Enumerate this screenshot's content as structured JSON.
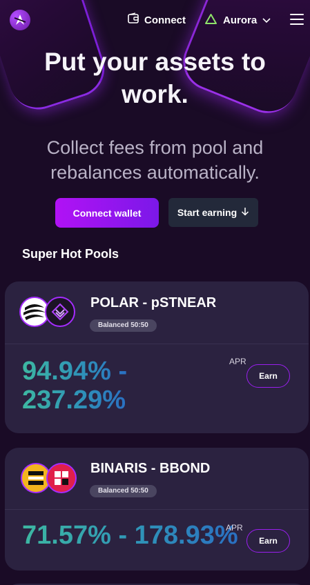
{
  "header": {
    "logo_icon": "aurora-logo-icon",
    "connect_label": "Connect",
    "network_label": "Aurora",
    "network_icon": "triangle-icon",
    "menu_icon": "hamburger-menu-icon"
  },
  "hero": {
    "title_line1": "Put your assets to",
    "title_line2": "work.",
    "subtitle_line1": "Collect fees from pool and",
    "subtitle_line2": "rebalances automatically.",
    "primary_button": "Connect wallet",
    "secondary_button": "Start earning",
    "secondary_icon": "arrow-down-icon"
  },
  "pools": {
    "section_title": "Super Hot Pools",
    "items": [
      {
        "pair": "POLAR - pSTNEAR",
        "badge": "Balanced 50:50",
        "apr_line1": "94.94% -",
        "apr_line2": "237.29%",
        "apr_label": "APR",
        "earn_label": "Earn"
      },
      {
        "pair": "BINARIS - BBOND",
        "badge": "Balanced 50:50",
        "apr_line1": "71.57% - 178.93%",
        "apr_label": "APR",
        "earn_label": "Earn"
      }
    ]
  },
  "colors": {
    "background": "#1a0b26",
    "card": "#2b2240",
    "accent_purple": "#a012f2",
    "apr_teal": "#3db8a2",
    "apr_blue": "#2a6fc2"
  }
}
